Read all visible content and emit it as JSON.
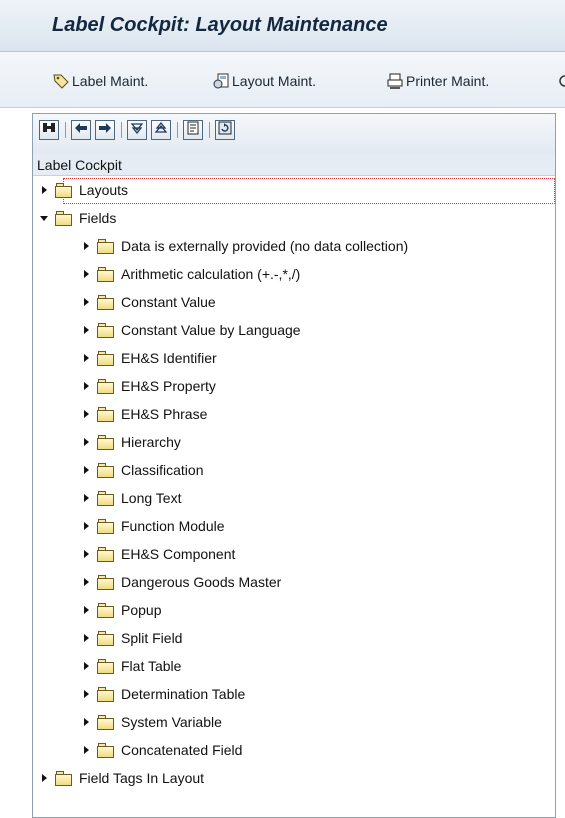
{
  "window": {
    "title": "Label Cockpit: Layout Maintenance"
  },
  "app_toolbar": {
    "buttons": [
      {
        "label": "Label Maint.",
        "icon": "label-tag-icon"
      },
      {
        "label": "Layout Maint.",
        "icon": "layout-icon"
      },
      {
        "label": "Printer Maint.",
        "icon": "printer-icon"
      }
    ]
  },
  "tree_toolbar": {
    "buttons": [
      {
        "icon": "find-icon"
      },
      {
        "icon": "arrow-left-icon"
      },
      {
        "icon": "arrow-right-icon"
      },
      {
        "icon": "expand-all-icon"
      },
      {
        "icon": "collapse-all-icon"
      },
      {
        "icon": "detail-icon"
      },
      {
        "icon": "refresh-icon"
      }
    ]
  },
  "tree": {
    "header": "Label Cockpit",
    "nodes": [
      {
        "label": "Layouts",
        "expanded": false,
        "level": 0,
        "selected": true
      },
      {
        "label": "Fields",
        "expanded": true,
        "level": 0
      },
      {
        "label": "Data is externally provided (no data collection)",
        "level": 1
      },
      {
        "label": "Arithmetic calculation (+.-,*,/)",
        "level": 1
      },
      {
        "label": "Constant Value",
        "level": 1
      },
      {
        "label": "Constant Value by Language",
        "level": 1
      },
      {
        "label": "EH&S Identifier",
        "level": 1
      },
      {
        "label": "EH&S Property",
        "level": 1
      },
      {
        "label": "EH&S Phrase",
        "level": 1
      },
      {
        "label": "Hierarchy",
        "level": 1
      },
      {
        "label": "Classification",
        "level": 1
      },
      {
        "label": "Long Text",
        "level": 1
      },
      {
        "label": "Function Module",
        "level": 1
      },
      {
        "label": "EH&S Component",
        "level": 1
      },
      {
        "label": "Dangerous Goods Master",
        "level": 1
      },
      {
        "label": "Popup",
        "level": 1
      },
      {
        "label": "Split Field",
        "level": 1
      },
      {
        "label": "Flat Table",
        "level": 1
      },
      {
        "label": "Determination Table",
        "level": 1
      },
      {
        "label": "System Variable",
        "level": 1
      },
      {
        "label": "Concatenated Field",
        "level": 1
      },
      {
        "label": "Field Tags In Layout",
        "expanded": false,
        "level": 0
      }
    ]
  },
  "colors": {
    "title_text": "#13283f",
    "focus_outline": "#e0353c",
    "folder_fill": "#f0db82"
  }
}
